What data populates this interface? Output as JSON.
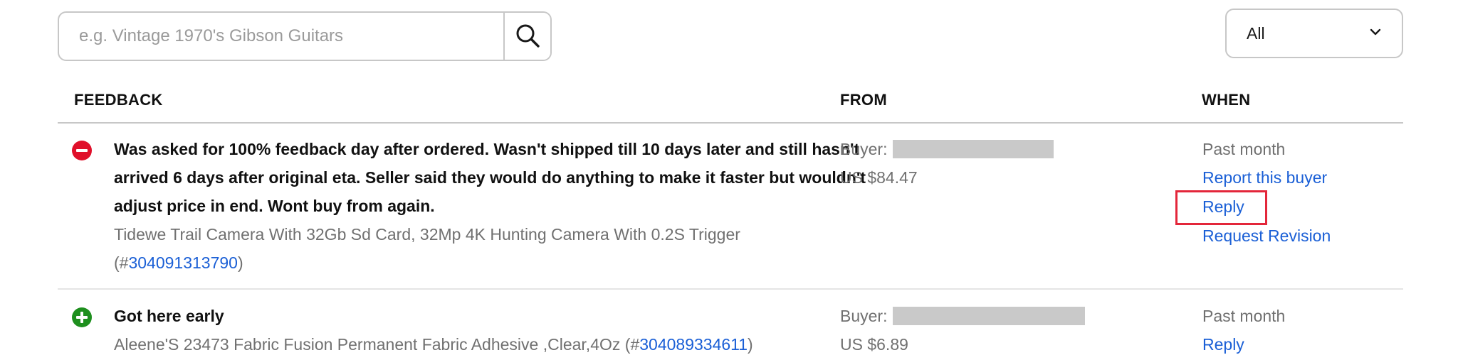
{
  "search": {
    "placeholder": "e.g. Vintage 1970's Gibson Guitars",
    "value": ""
  },
  "filter": {
    "selected": "All"
  },
  "columns": {
    "feedback": "FEEDBACK",
    "from": "FROM",
    "when": "WHEN"
  },
  "rows": [
    {
      "rating": "negative",
      "icon": "minus-circle-icon",
      "comment": "Was asked for 100% feedback day after ordered. Wasn't shipped till 10 days later and still hasn't arrived 6 days after original eta. Seller said they would do anything to make it faster but wouldn't adjust price in end. Wont buy from again.",
      "item_title": "Tidewe Trail Camera With 32Gb Sd Card, 32Mp 4K Hunting Camera With 0.2S Trigger",
      "item_prefix": "(#",
      "item_number": "304091313790",
      "item_suffix": ")",
      "from_label": "Buyer:",
      "price": "US $84.47",
      "when": "Past month",
      "actions": [
        "Report this buyer",
        "Reply",
        "Request Revision"
      ]
    },
    {
      "rating": "positive",
      "icon": "plus-circle-icon",
      "comment": "Got here early",
      "item_title": "Aleene'S 23473 Fabric Fusion Permanent Fabric Adhesive ,Clear,4Oz",
      "item_prefix": "(#",
      "item_number": "304089334611",
      "item_suffix": ")",
      "from_label": "Buyer:",
      "price": "US $6.89",
      "when": "Past month",
      "actions": [
        "Reply"
      ]
    }
  ],
  "colors": {
    "link": "#1a5fd6",
    "negative": "#e0102b",
    "positive": "#1e8f1e",
    "highlight": "#e3263a"
  }
}
